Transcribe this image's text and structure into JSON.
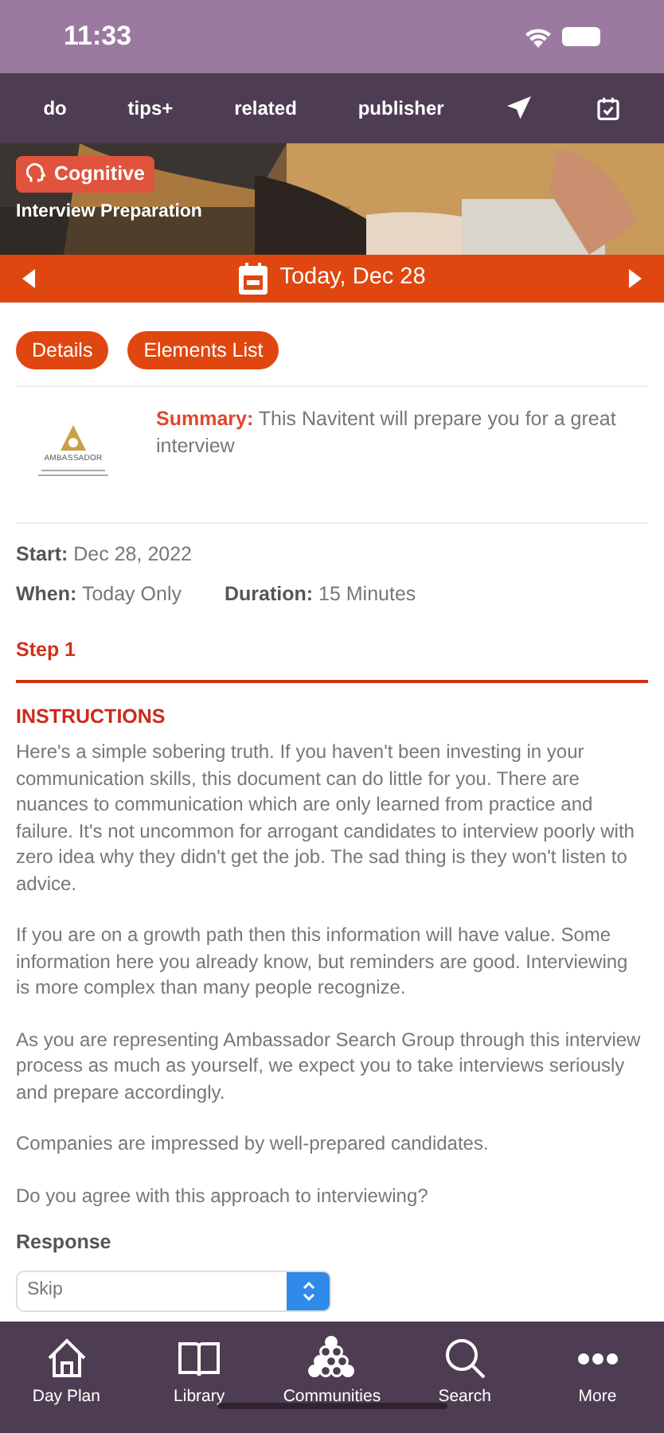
{
  "status_bar": {
    "time": "11:33"
  },
  "nav_bar": [
    {
      "kind": "text",
      "label": "do"
    },
    {
      "kind": "text",
      "label": "tips+"
    },
    {
      "kind": "text",
      "label": "related"
    },
    {
      "kind": "text",
      "label": "publisher"
    },
    {
      "kind": "icon"
    },
    {
      "kind": "icon"
    }
  ],
  "hero": {
    "badge": "Cognitive",
    "title": "Interview Preparation"
  },
  "date_bar": {
    "label": "Today, Dec 28"
  },
  "tabs": [
    {
      "label": "Details"
    },
    {
      "label": "Elements List"
    }
  ],
  "summary": {
    "logo_text": "AMBASSADOR",
    "label": "Summary:",
    "text": "This Navitent will prepare you for a great interview"
  },
  "start": {
    "label": "Start:",
    "value": "Dec 28, 2022"
  },
  "when": {
    "label": "When:",
    "value": "Today Only"
  },
  "duration": {
    "label": "Duration:",
    "value": "15 Minutes"
  },
  "step": {
    "title": "Step 1"
  },
  "instructions": {
    "heading": "INSTRUCTIONS",
    "paragraphs": [
      "Here's a simple sobering truth. If you haven't been investing in your communication skills, this document can do little for you. There are nuances to communication which are only learned from practice and failure. It's not uncommon for arrogant candidates to interview poorly with zero idea why they didn't get the job. The sad thing is they won't listen to advice.",
      "If you are on a growth path then this information will have value. Some information here you already know, but reminders are good. Interviewing is more complex than many people recognize.",
      "As you are representing Ambassador Search Group through this interview process as much as yourself, we expect you to take interviews seriously and prepare accordingly.",
      "Companies are impressed by well-prepared candidates.",
      "Do you agree with this approach to interviewing?"
    ]
  },
  "response": {
    "label": "Response",
    "value": "Skip"
  },
  "tab_bar": [
    {
      "label": "Day Plan"
    },
    {
      "label": "Library"
    },
    {
      "label": "Communities"
    },
    {
      "label": "Search"
    },
    {
      "label": "More"
    }
  ]
}
